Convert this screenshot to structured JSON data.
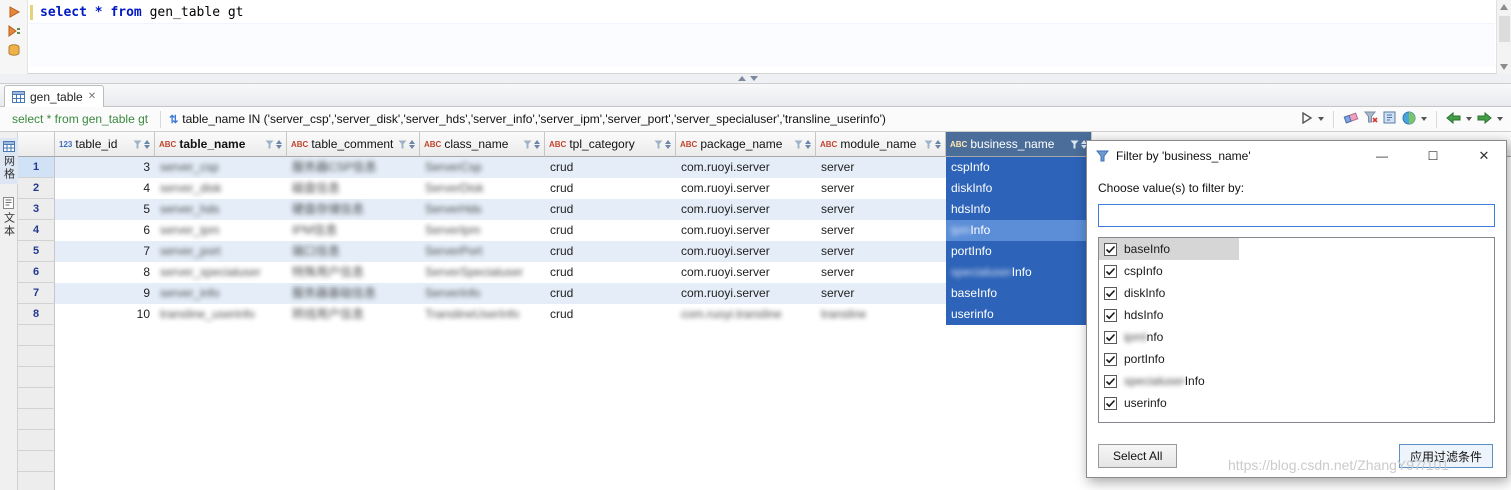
{
  "editor": {
    "code_keyword": "select * from",
    "code_rest": " gen_table gt"
  },
  "tab": {
    "label": "gen_table",
    "close_glyph": "✕"
  },
  "result_toolbar": {
    "query_text": "select * from gen_table gt",
    "filter_expression": "table_name IN ('server_csp','server_disk','server_hds','server_info','server_ipm','server_port','server_specialuser','transline_userinfo')"
  },
  "side_tabs": [
    {
      "label": "网格"
    },
    {
      "label": "文本"
    }
  ],
  "grid": {
    "columns": [
      {
        "type": "123",
        "name": "table_id"
      },
      {
        "type": "ABC",
        "name": "table_name",
        "bold": true
      },
      {
        "type": "ABC",
        "name": "table_comment"
      },
      {
        "type": "ABC",
        "name": "class_name"
      },
      {
        "type": "ABC",
        "name": "tpl_category"
      },
      {
        "type": "ABC",
        "name": "package_name"
      },
      {
        "type": "ABC",
        "name": "module_name"
      },
      {
        "type": "ABC",
        "name": "business_name",
        "selected": true
      }
    ],
    "rows": [
      {
        "row_num": "1",
        "table_id": "3",
        "table_name": "server_csp",
        "table_comment": "服务器CSP信息",
        "class_name": "ServerCsp",
        "tpl_category": "crud",
        "package_name": "com.ruoyi.server",
        "module_name": "server",
        "business_pre": "",
        "business_post": "cspInfo",
        "gutter_selected": true
      },
      {
        "row_num": "2",
        "table_id": "4",
        "table_name": "server_disk",
        "table_comment": "磁盘信息",
        "class_name": "ServerDisk",
        "tpl_category": "crud",
        "package_name": "com.ruoyi.server",
        "module_name": "server",
        "business_pre": "",
        "business_post": "diskInfo"
      },
      {
        "row_num": "3",
        "table_id": "5",
        "table_name": "server_hds",
        "table_comment": "硬盘存储信息",
        "class_name": "ServerHds",
        "tpl_category": "crud",
        "package_name": "com.ruoyi.server",
        "module_name": "server",
        "business_pre": "",
        "business_post": "hdsInfo"
      },
      {
        "row_num": "4",
        "table_id": "6",
        "table_name": "server_ipm",
        "table_comment": "IPM信息",
        "class_name": "ServerIpm",
        "tpl_category": "crud",
        "package_name": "com.ruoyi.server",
        "module_name": "server",
        "business_pre": "ipm",
        "business_pre_blur": true,
        "business_post": "Info",
        "highlight": true
      },
      {
        "row_num": "5",
        "table_id": "7",
        "table_name": "server_port",
        "table_comment": "端口信息",
        "class_name": "ServerPort",
        "tpl_category": "crud",
        "package_name": "com.ruoyi.server",
        "module_name": "server",
        "business_pre": "",
        "business_post": "portInfo"
      },
      {
        "row_num": "6",
        "table_id": "8",
        "table_name": "server_specialuser",
        "table_comment": "特殊用户信息",
        "class_name": "ServerSpecialuser",
        "tpl_category": "crud",
        "package_name": "com.ruoyi.server",
        "module_name": "server",
        "business_pre": "specialuser",
        "business_pre_blur": true,
        "business_post": "Info"
      },
      {
        "row_num": "7",
        "table_id": "9",
        "table_name": "server_info",
        "table_comment": "服务器基础信息",
        "class_name": "ServerInfo",
        "tpl_category": "crud",
        "package_name": "com.ruoyi.server",
        "module_name": "server",
        "business_pre": "",
        "business_post": "baseInfo"
      },
      {
        "row_num": "8",
        "table_id": "10",
        "table_name": "transline_userinfo",
        "table_comment": "转线用户信息",
        "class_name": "TranslineUserInfo",
        "tpl_category": "crud",
        "package_name": "com.ruoyi.transline",
        "package_blur": true,
        "module_name": "transline",
        "module_blur": true,
        "business_pre": "",
        "business_post": "userinfo"
      }
    ],
    "empty_row_count": 8
  },
  "dialog": {
    "title": "Filter by 'business_name'",
    "min_glyph": "—",
    "max_glyph": "☐",
    "close_glyph": "✕",
    "prompt": "Choose value(s) to filter by:",
    "input_value": "",
    "items": [
      {
        "pre": "",
        "label": "baseInfo",
        "checked": true,
        "selected": true
      },
      {
        "pre": "",
        "label": "cspInfo",
        "checked": true
      },
      {
        "pre": "",
        "label": "diskInfo",
        "checked": true
      },
      {
        "pre": "",
        "label": "hdsInfo",
        "checked": true
      },
      {
        "pre": "ipmI",
        "pre_blur": true,
        "label": "nfo",
        "checked": true
      },
      {
        "pre": "",
        "label": "portInfo",
        "checked": true
      },
      {
        "pre": "specialuser",
        "pre_blur": true,
        "label": "Info",
        "checked": true
      },
      {
        "pre": "",
        "label": "userinfo",
        "checked": true
      }
    ],
    "select_all_label": "Select All",
    "apply_label": "应用过滤条件"
  },
  "watermark": "https://blog.csdn.net/ZhangY97/101",
  "colors": {
    "business_cell": "#2d63b8",
    "business_cell_highlight": "#5c8ed8",
    "selected_header": "#4a6d99",
    "keyword_blue": "#0019c3",
    "query_green": "#3b8a3f"
  }
}
